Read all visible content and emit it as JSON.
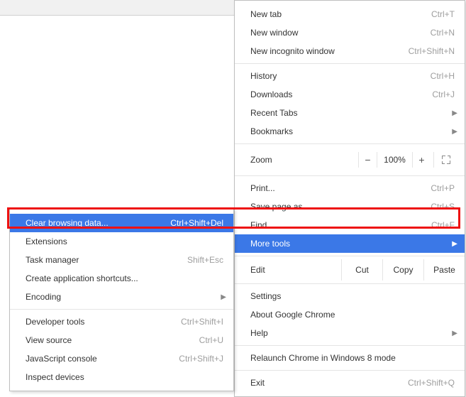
{
  "main": {
    "new_tab": "New tab",
    "new_tab_sc": "Ctrl+T",
    "new_window": "New window",
    "new_window_sc": "Ctrl+N",
    "incognito": "New incognito window",
    "incognito_sc": "Ctrl+Shift+N",
    "history": "History",
    "history_sc": "Ctrl+H",
    "downloads": "Downloads",
    "downloads_sc": "Ctrl+J",
    "recent_tabs": "Recent Tabs",
    "bookmarks": "Bookmarks",
    "zoom_label": "Zoom",
    "zoom_minus": "−",
    "zoom_val": "100%",
    "zoom_plus": "+",
    "print": "Print...",
    "print_sc": "Ctrl+P",
    "save_as": "Save page as...",
    "save_as_sc": "Ctrl+S",
    "find": "Find...",
    "find_sc": "Ctrl+F",
    "more_tools": "More tools",
    "edit": "Edit",
    "cut": "Cut",
    "copy": "Copy",
    "paste": "Paste",
    "settings": "Settings",
    "about": "About Google Chrome",
    "help": "Help",
    "relaunch": "Relaunch Chrome in Windows 8 mode",
    "exit": "Exit",
    "exit_sc": "Ctrl+Shift+Q"
  },
  "sub": {
    "clear": "Clear browsing data...",
    "clear_sc": "Ctrl+Shift+Del",
    "extensions": "Extensions",
    "task_mgr": "Task manager",
    "task_mgr_sc": "Shift+Esc",
    "create_shortcuts": "Create application shortcuts...",
    "encoding": "Encoding",
    "dev_tools": "Developer tools",
    "dev_tools_sc": "Ctrl+Shift+I",
    "view_source": "View source",
    "view_source_sc": "Ctrl+U",
    "js_console": "JavaScript console",
    "js_console_sc": "Ctrl+Shift+J",
    "inspect": "Inspect devices"
  }
}
